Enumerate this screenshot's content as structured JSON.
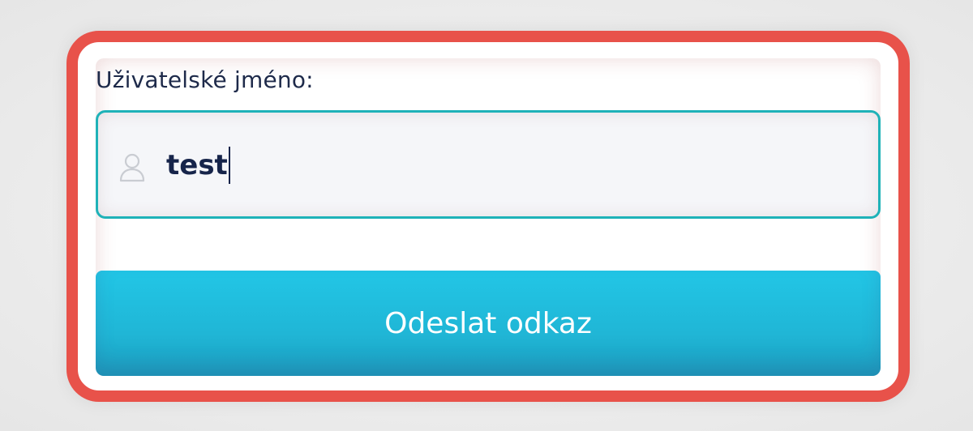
{
  "form": {
    "username_label": "Uživatelské jméno:",
    "username_value": "test",
    "user_icon": "user-icon",
    "submit_label": "Odeslat odkaz"
  },
  "colors": {
    "highlight_border": "#e8524a",
    "input_border": "#1fb2b8",
    "button_background": "#22c6e6",
    "text_dark": "#1e2a4a"
  }
}
